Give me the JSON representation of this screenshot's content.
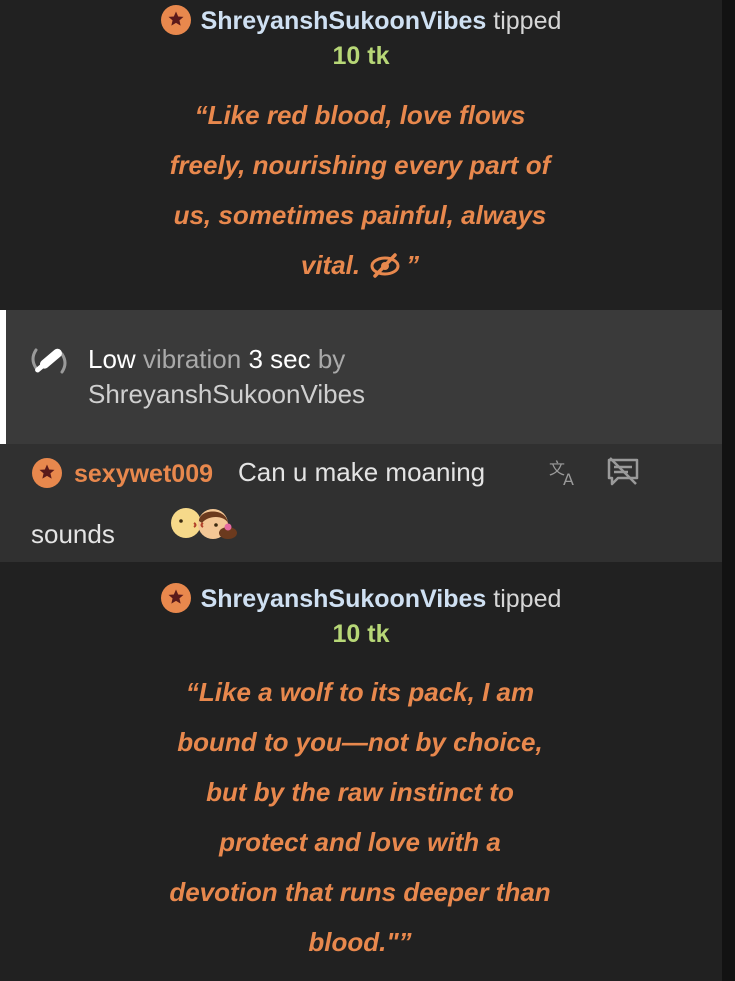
{
  "messages": [
    {
      "type": "tip",
      "username": "ShreyanshSukoonVibes",
      "action": "tipped",
      "amount": "10 tk",
      "quote_lines": [
        "“Like red blood, love flows",
        "freely, nourishing every part of",
        "us, sometimes painful, always",
        "vital."
      ],
      "quote_end": "”"
    },
    {
      "type": "vibration",
      "level": "Low",
      "word_vibration": "vibration",
      "duration": "3 sec",
      "word_by": "by",
      "username": "ShreyanshSukoonVibes"
    },
    {
      "type": "chat",
      "username": "sexywet009",
      "text_line1": "Can u make moaning",
      "text_line2": "sounds"
    },
    {
      "type": "tip",
      "username": "ShreyanshSukoonVibes",
      "action": "tipped",
      "amount": "10 tk",
      "quote_lines": [
        "“Like a wolf to its pack, I am",
        "bound to you—not by choice,",
        "but by the raw instinct to",
        "protect and love with a",
        "devotion that runs deeper than",
        "blood.\"”"
      ]
    }
  ],
  "icons": {
    "badge": "star-badge-icon",
    "hidden": "eye-slash-icon",
    "vibration": "vibration-icon",
    "translate": "translate-icon",
    "hide_message": "hide-message-icon",
    "emoji": "kissing-couple-emoji"
  },
  "colors": {
    "background": "#212121",
    "vibration_bg": "#3a3a3a",
    "chat_bg": "#303030",
    "accent_orange": "#e8884d",
    "username_blue": "#cfe0f2",
    "amount_green": "#b7d777"
  }
}
